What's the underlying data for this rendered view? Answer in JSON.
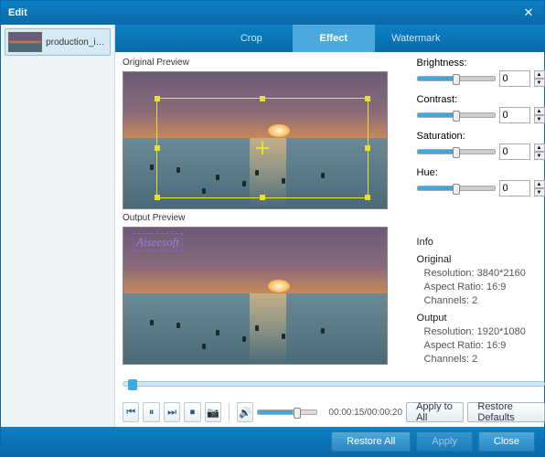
{
  "window": {
    "title": "Edit"
  },
  "sidebar": {
    "items": [
      {
        "name": "production_id..."
      }
    ]
  },
  "tabs": [
    {
      "label": "Crop"
    },
    {
      "label": "Effect"
    },
    {
      "label": "Watermark"
    }
  ],
  "active_tab": 1,
  "preview": {
    "original_label": "Original Preview",
    "output_label": "Output Preview",
    "watermark_text": "Aiseesoft"
  },
  "sliders": {
    "brightness": {
      "label": "Brightness:",
      "value": "0"
    },
    "contrast": {
      "label": "Contrast:",
      "value": "0"
    },
    "saturation": {
      "label": "Saturation:",
      "value": "0"
    },
    "hue": {
      "label": "Hue:",
      "value": "0"
    }
  },
  "info": {
    "header": "Info",
    "original": {
      "title": "Original",
      "resolution": "Resolution: 3840*2160",
      "aspect": "Aspect Ratio: 16:9",
      "channels": "Channels: 2"
    },
    "output": {
      "title": "Output",
      "resolution": "Resolution: 1920*1080",
      "aspect": "Aspect Ratio: 16:9",
      "channels": "Channels: 2"
    }
  },
  "playback": {
    "time": "00:00:15/00:00:20"
  },
  "buttons": {
    "apply_all": "Apply to All",
    "restore_defaults": "Restore Defaults",
    "restore_all": "Restore All",
    "apply": "Apply",
    "close": "Close"
  }
}
